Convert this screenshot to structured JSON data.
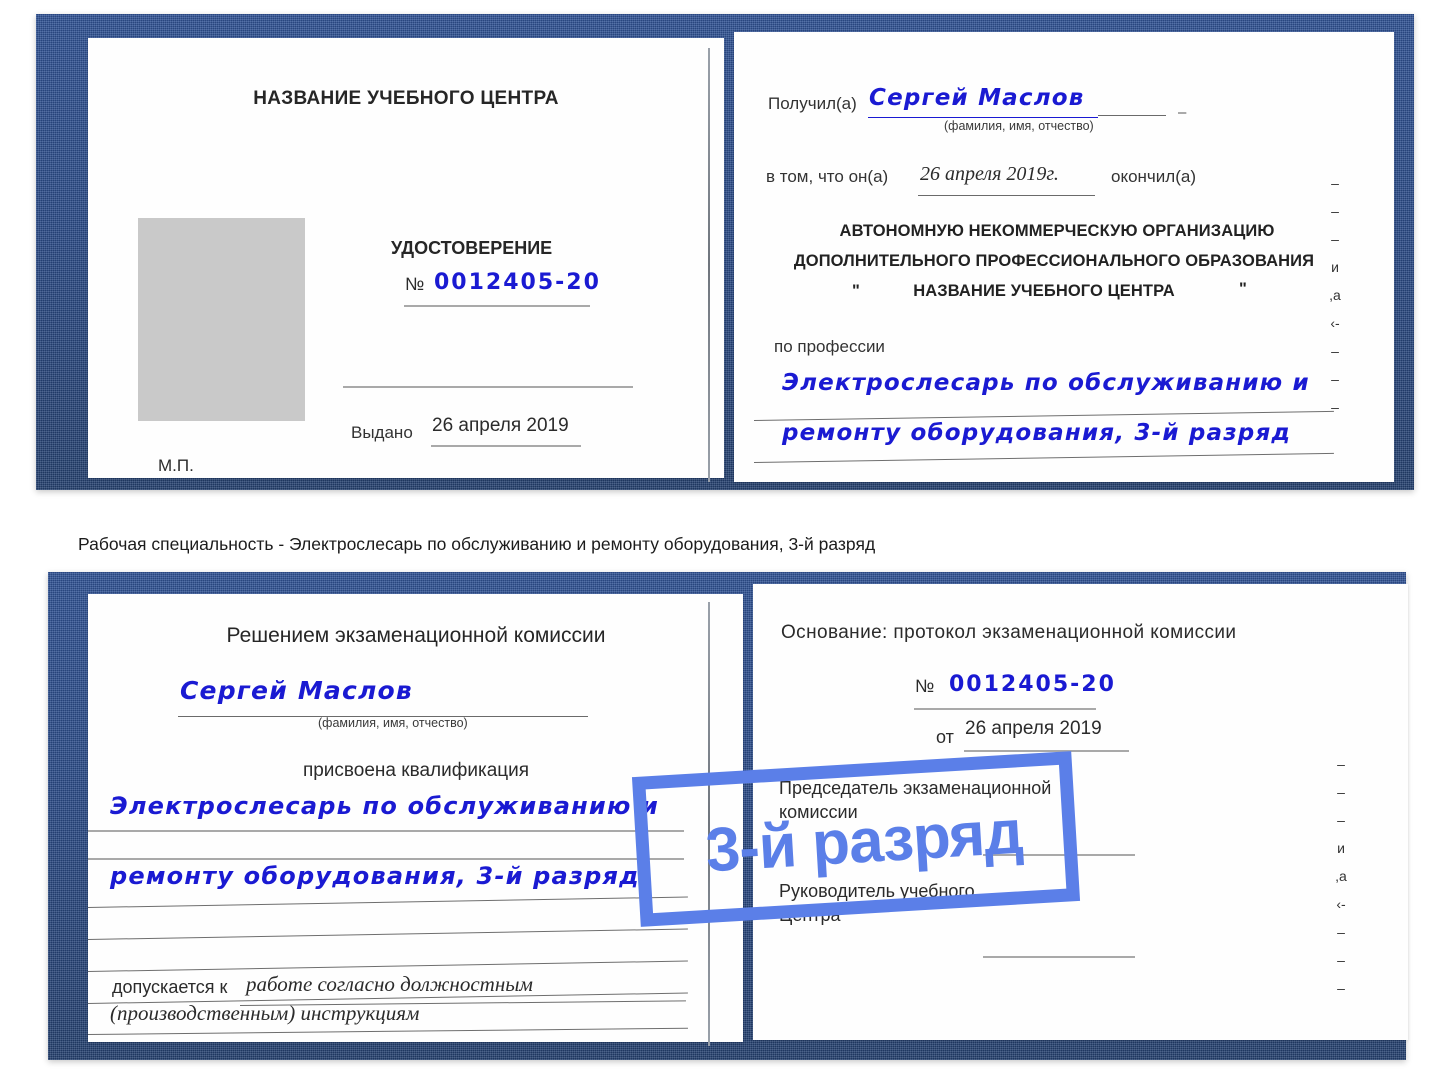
{
  "colors": {
    "cover_blue": "#2a4a87",
    "ink_blue": "#1a1ad2",
    "badge_blue": "#5b7fe8",
    "rule_gray": "#a9a9a9",
    "photo_gray": "#c9c9c9"
  },
  "certificate_front": {
    "left_page": {
      "center_title": "НАЗВАНИЕ УЧЕБНОГО ЦЕНТРА",
      "doc_type": "УДОСТОВЕРЕНИЕ",
      "number_symbol": "№",
      "number_value": "0012405-20",
      "issued_label": "Выдано",
      "issued_value": "26 апреля 2019",
      "stamp_label": "М.П.",
      "photo_placeholder": "photo-placeholder"
    },
    "right_page": {
      "received_label": "Получил(а)",
      "received_value": "Сергей Маслов",
      "fio_hint": "(фамилия, имя, отчество)",
      "in_that_label": "в том, что он(а)",
      "completion_date": "26 апреля 2019г.",
      "finished_label": "окончил(а)",
      "org_line1": "АВТОНОМНУЮ НЕКОММЕРЧЕСКУЮ ОРГАНИЗАЦИЮ",
      "org_line2": "ДОПОЛНИТЕЛЬНОГО ПРОФЕССИОНАЛЬНОГО ОБРАЗОВАНИЯ",
      "org_quote_open": "\"",
      "org_line3": "НАЗВАНИЕ УЧЕБНОГО ЦЕНТРА",
      "org_quote_close": "\"",
      "profession_label": "по профессии",
      "profession_line1": "Электрослесарь по обслуживанию и",
      "profession_line2": "ремонту оборудования, 3-й разряд",
      "edge_column": "— — — и ,а ‹- — — —"
    }
  },
  "caption": "Рабочая специальность - Электрослесарь по обслуживанию и ремонту оборудования, 3-й разряд",
  "certificate_back": {
    "left_page": {
      "title": "Решением экзаменационной комиссии",
      "name_value": "Сергей Маслов",
      "fio_hint": "(фамилия, имя, отчество)",
      "qualification_label": "присвоена квалификация",
      "qualification_line1": "Электрослесарь по обслуживанию и",
      "qualification_line2": "ремонту оборудования, 3-й разряд",
      "admitted_label": "допускается к",
      "admitted_value_line1": "работе согласно должностным",
      "admitted_value_line2": "(производственным) инструкциям"
    },
    "right_page": {
      "basis_label": "Основание: протокол экзаменационной комиссии",
      "number_symbol": "№",
      "number_value": "0012405-20",
      "date_label": "от",
      "date_value": "26 апреля 2019",
      "chairman_line1": "Председатель экзаменационной",
      "chairman_line2": "комиссии",
      "head_line1": "Руководитель учебного",
      "head_line2": "Центра",
      "edge_column": "— — — и ,а ‹- — — —"
    }
  },
  "badge": {
    "label": "3-й разряд"
  }
}
